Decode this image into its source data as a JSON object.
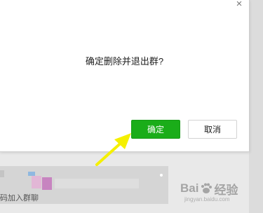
{
  "dialog": {
    "message": "确定删除并退出群?",
    "close_symbol": "×",
    "ok_label": "确定",
    "cancel_label": "取消"
  },
  "background_panel": {
    "text": "码加入群聊"
  },
  "watermark": {
    "text_left": "Bai",
    "text_right": "经验",
    "sub": "jingyan.baidu.com"
  },
  "colors": {
    "primary_green": "#1aad19",
    "arrow_yellow": "#f5f000"
  }
}
